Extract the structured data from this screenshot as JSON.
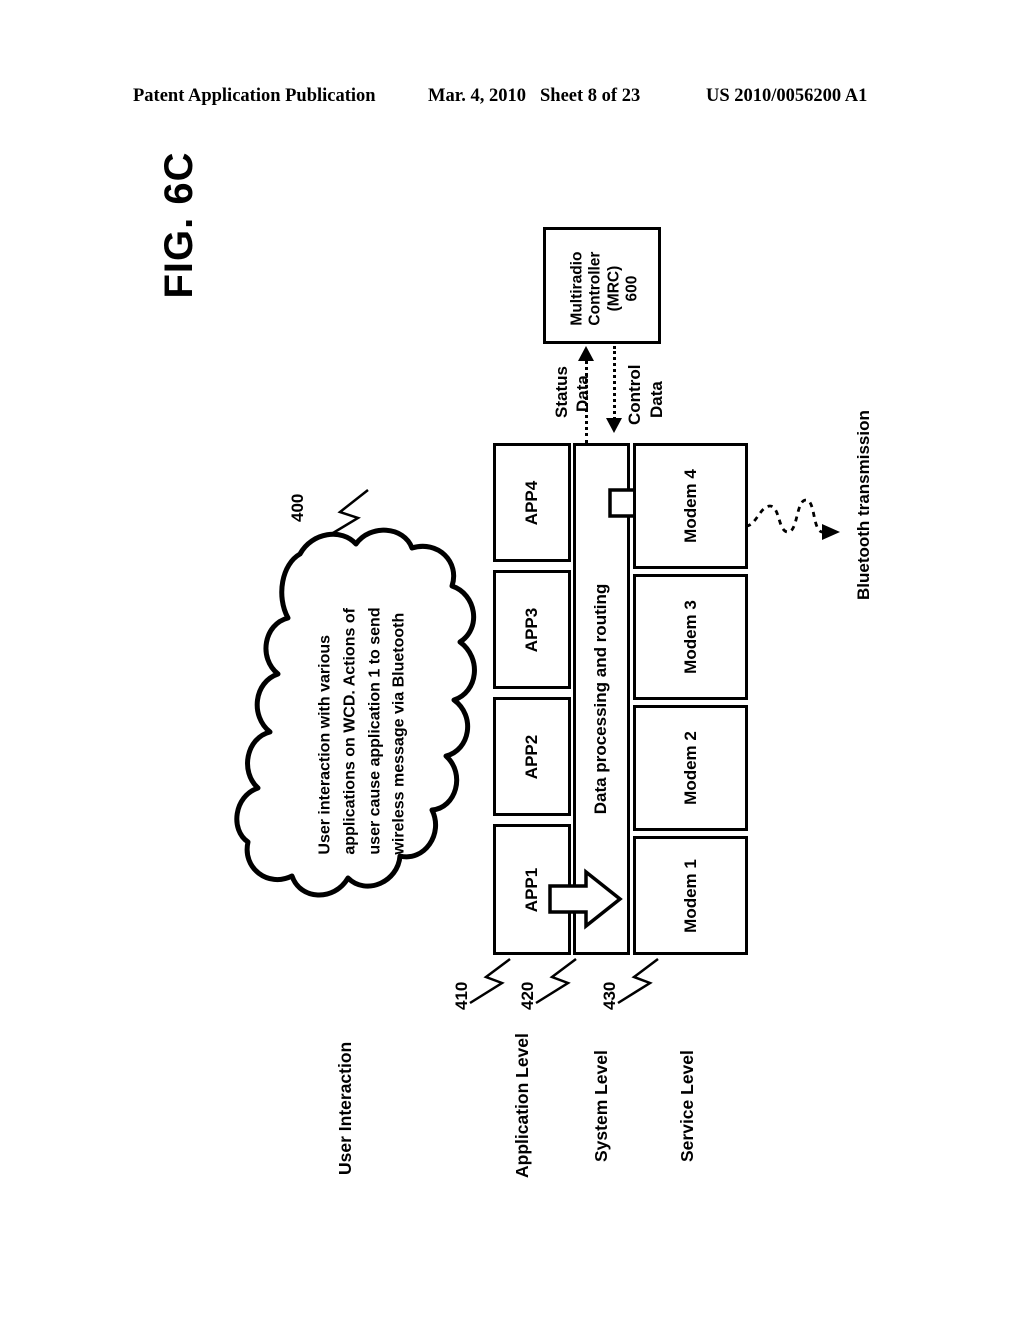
{
  "header": {
    "publication": "Patent Application Publication",
    "date": "Mar. 4, 2010",
    "sheet": "Sheet 8 of 23",
    "patent_number": "US 2010/0056200 A1"
  },
  "figure": {
    "label": "FIG. 6C"
  },
  "mrc": {
    "line1": "Multiradio",
    "line2": "Controller",
    "line3": "(MRC)",
    "line4": "600"
  },
  "signals": {
    "status_line1": "Status",
    "status_line2": "Data",
    "control_line1": "Control",
    "control_line2": "Data"
  },
  "cloud": {
    "ref": "400",
    "line1": "User interaction with various",
    "line2": "applications on WCD.  Actions of",
    "line3": "user cause application 1 to send",
    "line4": "wireless message via Bluetooth"
  },
  "apps": {
    "ref": "420",
    "items": [
      {
        "label": "APP1"
      },
      {
        "label": "APP2"
      },
      {
        "label": "APP3"
      },
      {
        "label": "APP4"
      }
    ]
  },
  "processing": {
    "ref": "430",
    "label": "Data processing and routing"
  },
  "modems": {
    "items": [
      {
        "label": "Modem 1"
      },
      {
        "label": "Modem 2"
      },
      {
        "label": "Modem 3"
      },
      {
        "label": "Modem 4"
      }
    ]
  },
  "user_interaction": {
    "ref": "410"
  },
  "levels": [
    {
      "label": "User Interaction"
    },
    {
      "label": "Application Level"
    },
    {
      "label": "System Level"
    },
    {
      "label": "Service Level"
    }
  ],
  "transmission": {
    "label": "Bluetooth transmission"
  }
}
